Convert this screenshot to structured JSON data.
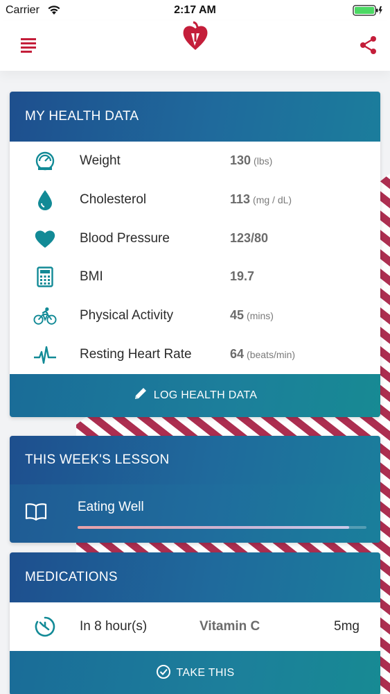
{
  "status_bar": {
    "carrier": "Carrier",
    "time": "2:17 AM"
  },
  "nav": {
    "menu_icon": "menu-icon",
    "logo": "american-heart-association-logo",
    "share_icon": "share-icon"
  },
  "colors": {
    "brand_red": "#c41e3a",
    "teal": "#128a96",
    "header_blue": "#1e4f8e"
  },
  "health_data": {
    "title": "MY HEALTH DATA",
    "rows": [
      {
        "icon": "gauge-icon",
        "label": "Weight",
        "value": "130",
        "unit": "(lbs)"
      },
      {
        "icon": "drop-icon",
        "label": "Cholesterol",
        "value": "113",
        "unit": "(mg / dL)"
      },
      {
        "icon": "heart-icon",
        "label": "Blood Pressure",
        "value": "123/80",
        "unit": ""
      },
      {
        "icon": "calculator-icon",
        "label": "BMI",
        "value": "19.7",
        "unit": ""
      },
      {
        "icon": "bicycle-icon",
        "label": "Physical Activity",
        "value": "45",
        "unit": "(mins)"
      },
      {
        "icon": "heartbeat-icon",
        "label": "Resting Heart Rate",
        "value": "64",
        "unit": "(beats/min)"
      }
    ],
    "log_button": "LOG HEALTH DATA"
  },
  "lesson": {
    "title": "THIS WEEK'S LESSON",
    "lesson_name": "Eating Well",
    "progress": 0.94
  },
  "medications": {
    "title": "MEDICATIONS",
    "time": "In 8 hour(s)",
    "name": "Vitamin C",
    "dose": "5mg",
    "take_button": "TAKE THIS"
  }
}
